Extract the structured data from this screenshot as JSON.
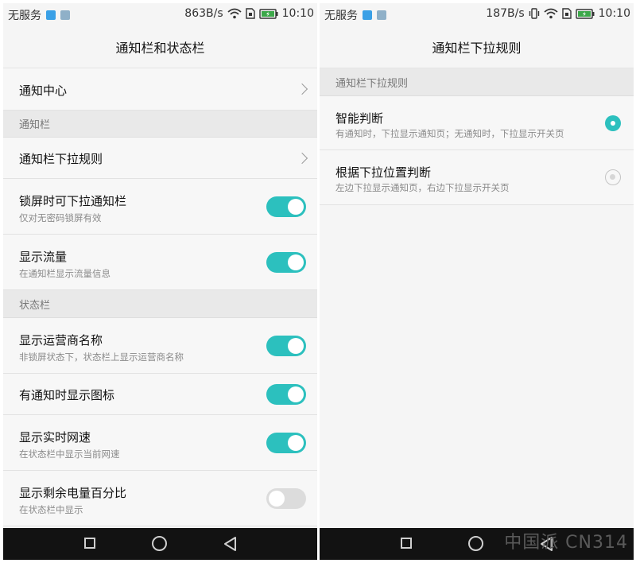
{
  "left": {
    "status": {
      "carrier": "无服务",
      "speed": "863B/s",
      "time": "10:10"
    },
    "title": "通知栏和状态栏",
    "rows": [
      {
        "title": "通知中心"
      },
      {
        "section": "通知栏"
      },
      {
        "title": "通知栏下拉规则"
      },
      {
        "title": "锁屏时可下拉通知栏",
        "subtitle": "仅对无密码锁屏有效",
        "toggle": true
      },
      {
        "title": "显示流量",
        "subtitle": "在通知栏显示流量信息",
        "toggle": true
      },
      {
        "section": "状态栏"
      },
      {
        "title": "显示运营商名称",
        "subtitle": "非锁屏状态下，状态栏上显示运营商名称",
        "toggle": true
      },
      {
        "title": "有通知时显示图标",
        "toggle": true
      },
      {
        "title": "显示实时网速",
        "subtitle": "在状态栏中显示当前网速",
        "toggle": true
      },
      {
        "title": "显示剩余电量百分比",
        "subtitle": "在状态栏中显示",
        "toggle": false
      }
    ]
  },
  "right": {
    "status": {
      "carrier": "无服务",
      "speed": "187B/s",
      "time": "10:10"
    },
    "title": "通知栏下拉规则",
    "section": "通知栏下拉规则",
    "options": [
      {
        "title": "智能判断",
        "subtitle": "有通知时，下拉显示通知页；无通知时，下拉显示开关页",
        "selected": true
      },
      {
        "title": "根据下拉位置判断",
        "subtitle": "左边下拉显示通知页，右边下拉显示开关页",
        "selected": false
      }
    ]
  },
  "watermark": "中国派  CN314",
  "colors": {
    "accent": "#2cc0be",
    "toggle_off": "#dcdcdc",
    "navbar": "#121212"
  }
}
